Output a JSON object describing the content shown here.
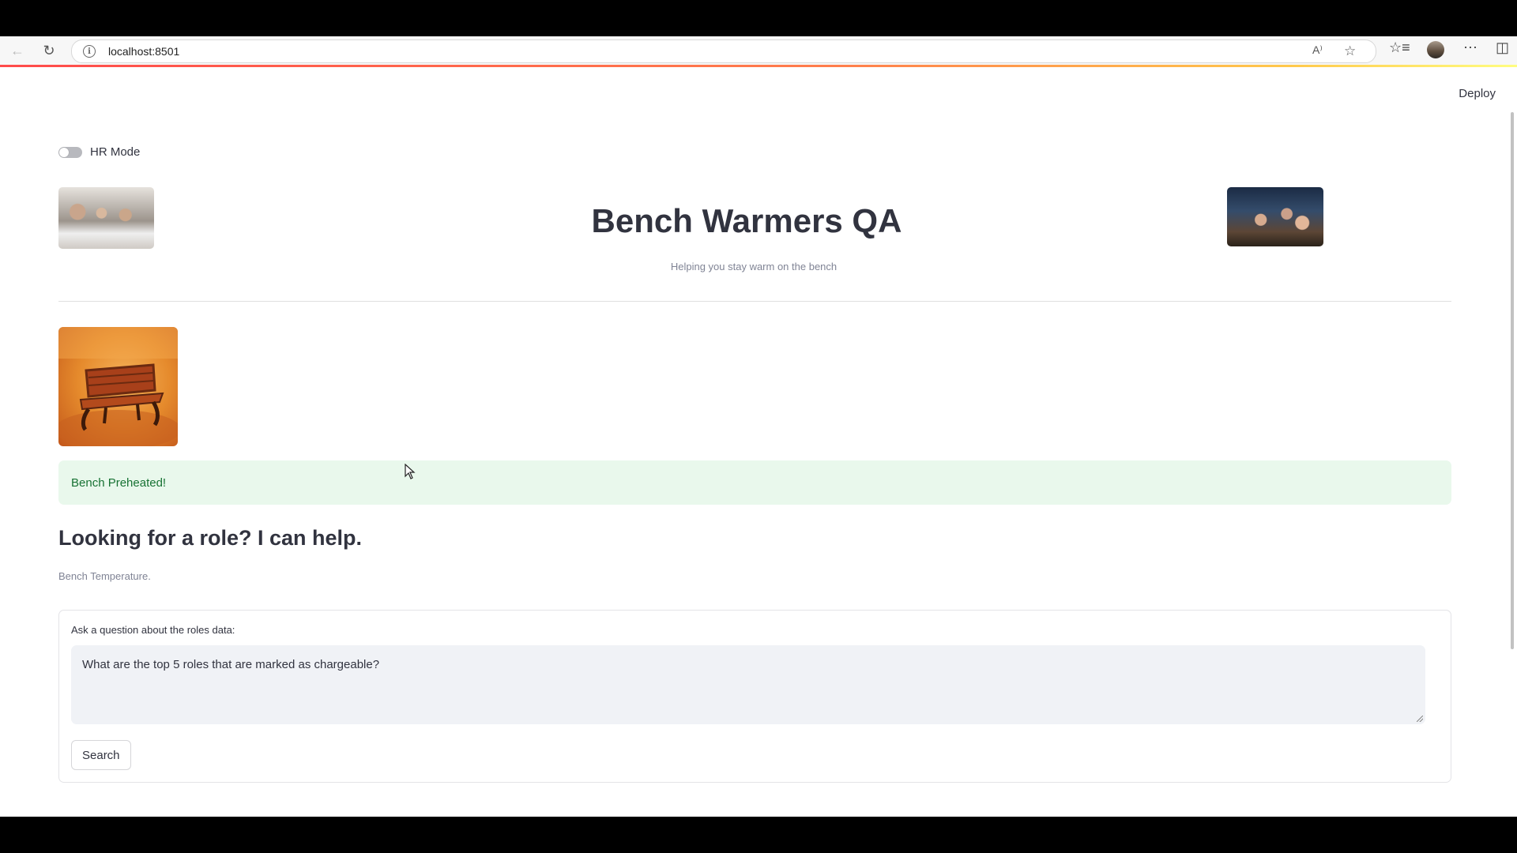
{
  "browser": {
    "url": "localhost:8501",
    "back_icon": "back-arrow-icon",
    "reload_icon": "reload-icon",
    "info_icon": "info-icon",
    "read_aloud_label": "A⁾"
  },
  "app": {
    "deploy_label": "Deploy",
    "hr_toggle": {
      "label": "HR Mode",
      "checked": false
    },
    "title": "Bench Warmers QA",
    "subtitle": "Helping you stay warm on the bench",
    "alert_text": "Bench Preheated!",
    "heading": "Looking for a role? I can help.",
    "caption": "Bench Temperature.",
    "query_form": {
      "label": "Ask a question about the roles data:",
      "value": "What are the top 5 roles that are marked as chargeable?",
      "button_label": "Search"
    },
    "colors": {
      "alert_bg": "#e9f8ec",
      "alert_text": "#177233",
      "progress_start": "#ff4b4b",
      "progress_end": "#fffd80"
    }
  }
}
